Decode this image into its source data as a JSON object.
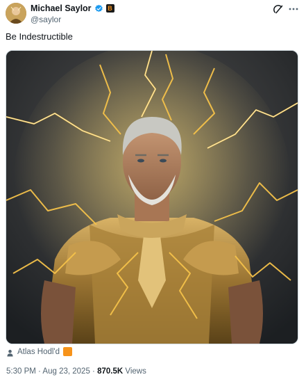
{
  "author": {
    "display_name": "Michael Saylor",
    "handle": "@saylor",
    "verified_color": "#1d9bf0",
    "affiliate_badge_glyph": "B",
    "affiliate_badge_color": "#f7931a"
  },
  "tweet": {
    "text": "Be Indestructible"
  },
  "media": {
    "icon": "image",
    "lightning_color": "#f5c24a",
    "armor_color": "#b08a3e"
  },
  "tag": {
    "label": "Atlas Hodl'd",
    "badge_color": "#f7931a"
  },
  "meta": {
    "time": "5:30 PM",
    "separator": " · ",
    "date": "Aug 23, 2025",
    "views_count": "870.5K",
    "views_label": "Views"
  },
  "icons": [
    "grok-icon",
    "more-icon",
    "verified-icon",
    "person-icon"
  ]
}
